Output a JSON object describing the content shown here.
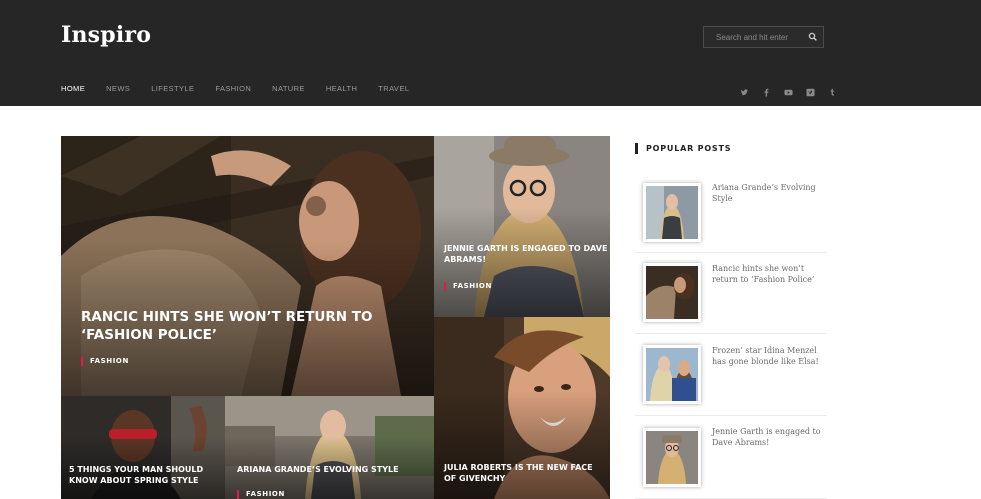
{
  "header": {
    "logo": "Inspiro",
    "search_placeholder": "Search and hit enter",
    "nav": [
      "HOME",
      "NEWS",
      "LIFESTYLE",
      "FASHION",
      "NATURE",
      "HEALTH",
      "TRAVEL"
    ],
    "social_icons": [
      "twitter-icon",
      "facebook-icon",
      "youtube-icon",
      "vimeo-icon",
      "tumblr-icon"
    ],
    "social_glyphs": [
      "𝕥",
      "f",
      "▶",
      "v",
      "t"
    ]
  },
  "featured": [
    {
      "title": "RANCIC HINTS SHE WON’T RETURN TO ‘FASHION POLICE’",
      "category": "FASHION"
    },
    {
      "title": "JENNIE GARTH IS ENGAGED TO DAVE ABRAMS!",
      "category": "FASHION"
    },
    {
      "title": "5 THINGS YOUR MAN SHOULD KNOW ABOUT SPRING STYLE"
    },
    {
      "title": "ARIANA GRANDE’S EVOLVING STYLE",
      "category": "FASHION"
    },
    {
      "title": "JULIA ROBERTS IS THE NEW FACE OF GIVENCHY"
    }
  ],
  "sidebar": {
    "heading": "POPULAR POSTS",
    "posts": [
      {
        "title": "Ariana Grande’s Evolving Style"
      },
      {
        "title": "Rancic hints she won’t return to ‘Fashion Police’"
      },
      {
        "title": "Frozen’ star Idina Menzel has gone blonde like Elsa!"
      },
      {
        "title": "Jennie Garth is engaged to Dave Abrams!"
      }
    ]
  },
  "colors": {
    "header_bg": "#262626",
    "accent": "#e8174b",
    "nav_active": "#ffffff",
    "nav": "#9a9a9a"
  }
}
